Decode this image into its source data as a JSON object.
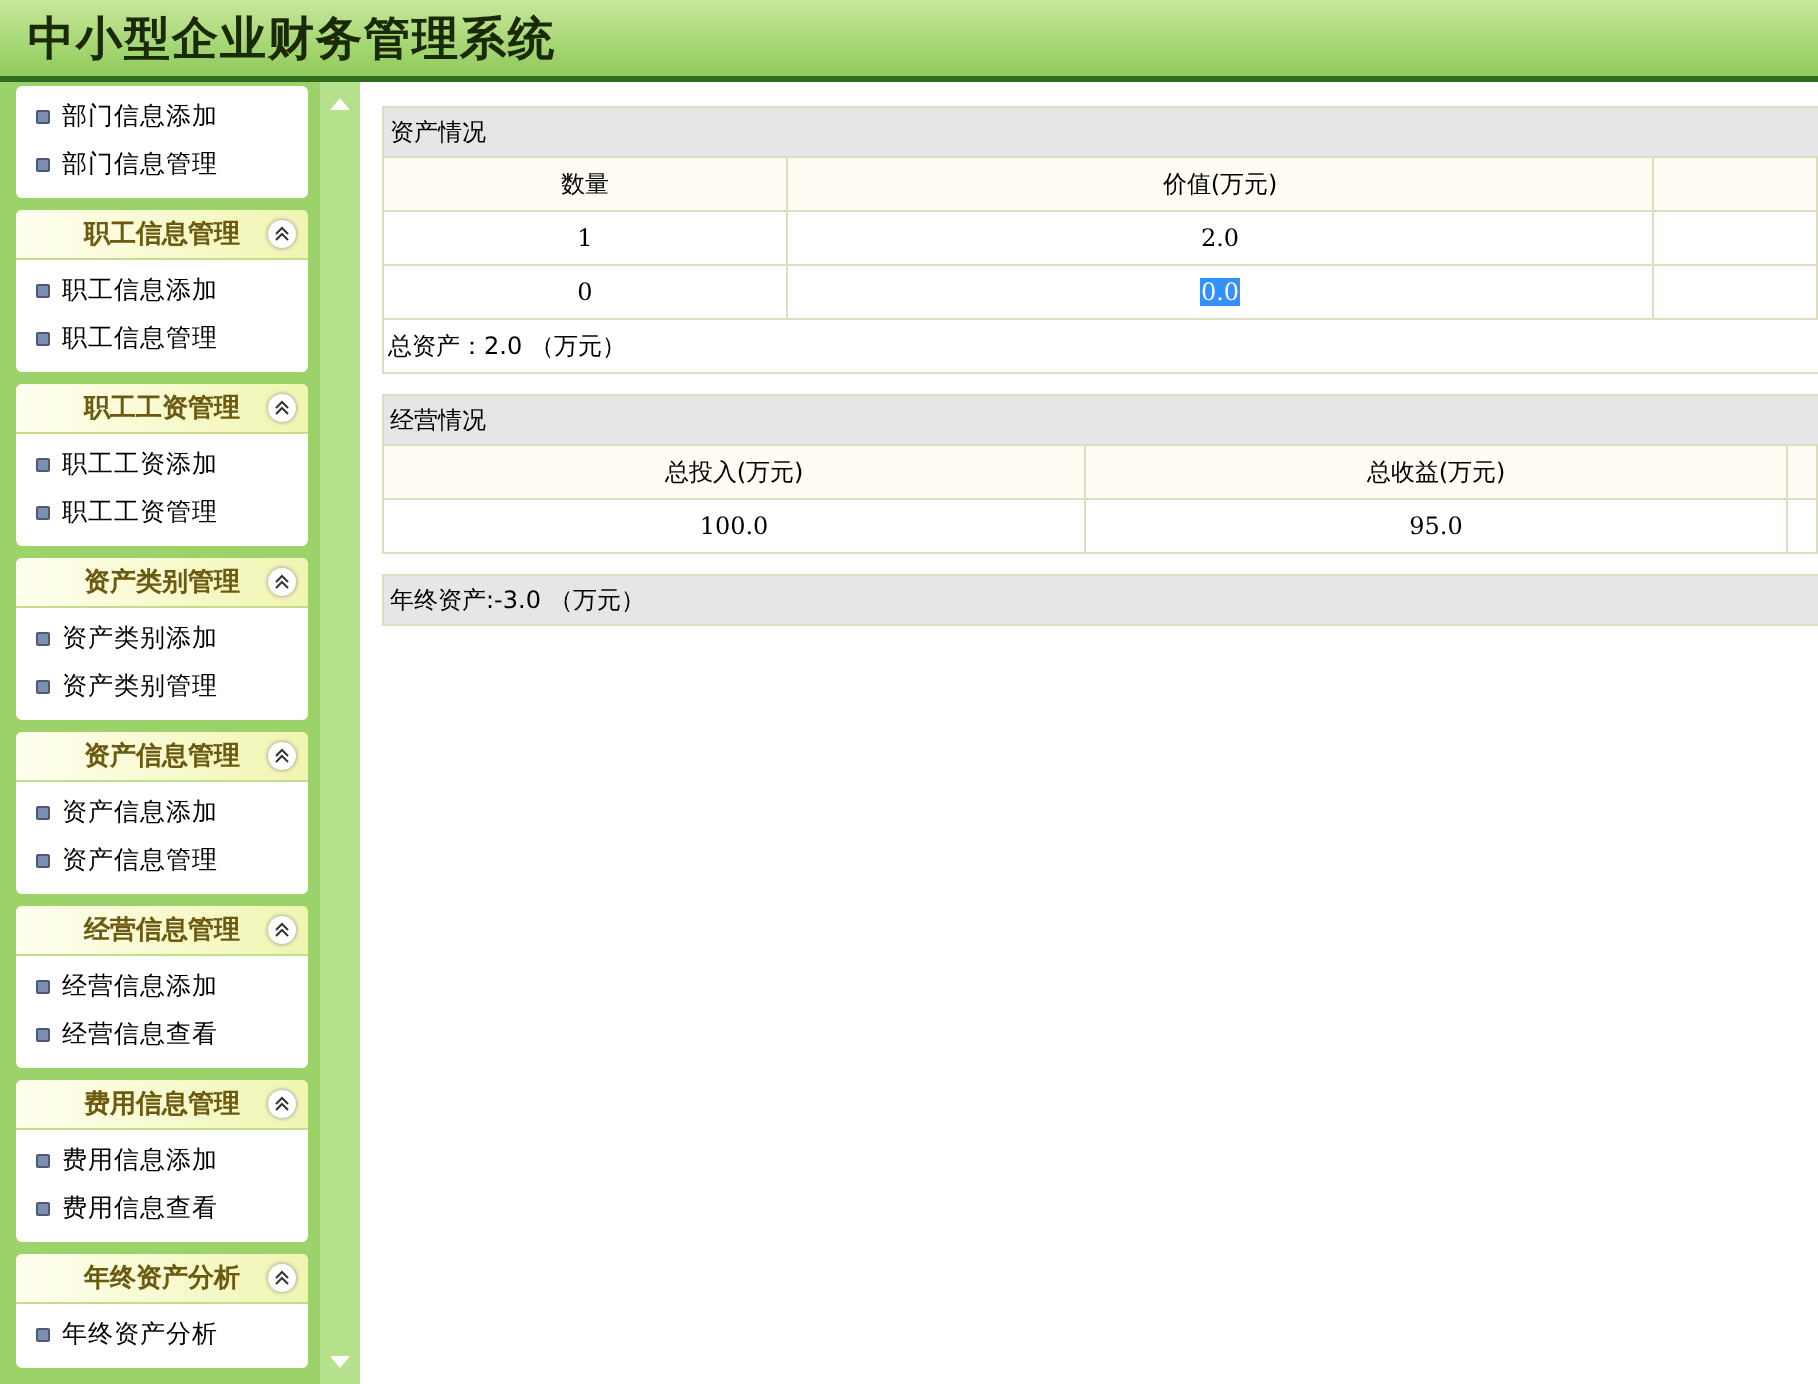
{
  "header": {
    "title": "中小型企业财务管理系统"
  },
  "sidebar": {
    "groups": [
      {
        "items": [
          "部门信息添加",
          "部门信息管理"
        ]
      },
      {
        "title": "职工信息管理",
        "expanded": true,
        "items": [
          "职工信息添加",
          "职工信息管理"
        ]
      },
      {
        "title": "职工工资管理",
        "expanded": true,
        "items": [
          "职工工资添加",
          "职工工资管理"
        ]
      },
      {
        "title": "资产类别管理",
        "expanded": true,
        "items": [
          "资产类别添加",
          "资产类别管理"
        ]
      },
      {
        "title": "资产信息管理",
        "expanded": true,
        "items": [
          "资产信息添加",
          "资产信息管理"
        ]
      },
      {
        "title": "经营信息管理",
        "expanded": true,
        "items": [
          "经营信息添加",
          "经营信息查看"
        ]
      },
      {
        "title": "费用信息管理",
        "expanded": true,
        "items": [
          "费用信息添加",
          "费用信息查看"
        ]
      },
      {
        "title": "年终资产分析",
        "expanded": true,
        "items": [
          "年终资产分析"
        ]
      }
    ]
  },
  "assets": {
    "title": "资产情况",
    "columns": [
      "数量",
      "价值(万元)"
    ],
    "rows": [
      [
        {
          "text": "1",
          "selected": false
        },
        {
          "text": "2.0",
          "selected": false
        }
      ],
      [
        {
          "text": "0",
          "selected": false
        },
        {
          "text": "0.0",
          "selected": true
        }
      ]
    ],
    "total": "总资产：2.0 （万元）"
  },
  "business": {
    "title": "经营情况",
    "columns": [
      "总投入(万元)",
      "总收益(万元)"
    ],
    "rows": [
      [
        {
          "text": "100.0",
          "selected": false
        },
        {
          "text": "95.0",
          "selected": false
        }
      ]
    ]
  },
  "year_end": "年终资产:-3.0 （万元）"
}
